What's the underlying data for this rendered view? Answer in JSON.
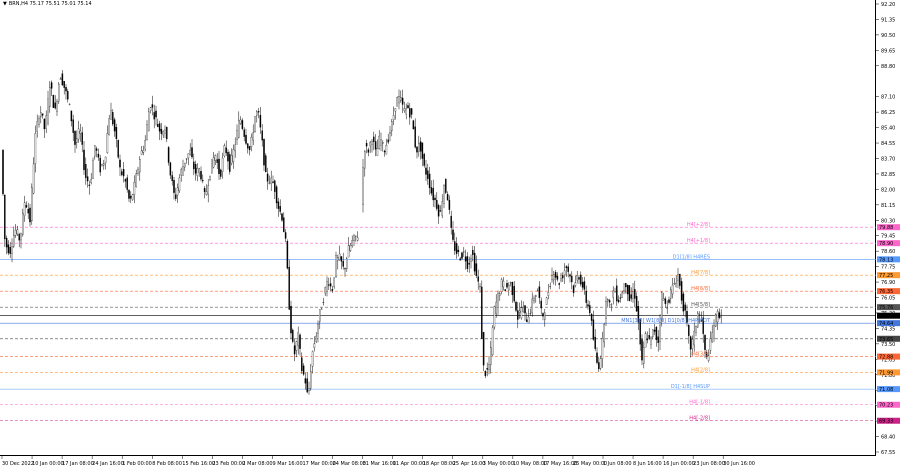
{
  "window": {
    "title": "BRN,H4  75.17 75.51 75.01 75.14"
  },
  "chart_data": {
    "type": "candlestick",
    "y_range": [
      67.55,
      92.2
    ],
    "price_ticks": [
      "92.20",
      "91.35",
      "90.50",
      "89.65",
      "88.80",
      "87.10",
      "86.25",
      "85.40",
      "84.55",
      "83.70",
      "82.85",
      "82.00",
      "81.15",
      "80.30",
      "79.45",
      "78.60",
      "77.75",
      "76.90",
      "76.05",
      "75.20",
      "74.35",
      "73.50",
      "72.65",
      "71.80",
      "70.95",
      "70.10",
      "69.25",
      "68.40",
      "67.55"
    ],
    "date_ticks": [
      "30 Dec 2022",
      "10 Jan 00:00",
      "17 Jan 08:00",
      "24 Jan 16:00",
      "1 Feb 00:00",
      "8 Feb 08:00",
      "15 Feb 16:00",
      "23 Feb 00:00",
      "2 Mar 08:00",
      "9 Mar 16:00",
      "17 Mar 00:00",
      "24 Mar 08:00",
      "31 Mar 16:00",
      "11 Apr 00:00",
      "18 Apr 08:00",
      "25 Apr 16:00",
      "3 May 00:00",
      "10 May 08:00",
      "17 May 16:00",
      "25 May 00:00",
      "1 Jun 08:00",
      "8 Jun 16:00",
      "16 Jun 00:00",
      "23 Jun 08:00",
      "30 Jun 16:00"
    ],
    "price_path": [
      [
        0,
        85.8
      ],
      [
        5,
        79
      ],
      [
        10,
        78.6
      ],
      [
        15,
        79.8
      ],
      [
        20,
        79.2
      ],
      [
        25,
        81.5
      ],
      [
        30,
        80.3
      ],
      [
        35,
        84.8
      ],
      [
        40,
        86.5
      ],
      [
        45,
        85.2
      ],
      [
        50,
        87.9
      ],
      [
        55,
        86.2
      ],
      [
        60,
        88.4
      ],
      [
        65,
        87.5
      ],
      [
        70,
        86.4
      ],
      [
        75,
        84.5
      ],
      [
        80,
        85.3
      ],
      [
        85,
        82.8
      ],
      [
        90,
        82.2
      ],
      [
        95,
        84.5
      ],
      [
        100,
        83.1
      ],
      [
        105,
        83.7
      ],
      [
        110,
        86.5
      ],
      [
        115,
        85.1
      ],
      [
        120,
        83.1
      ],
      [
        125,
        82.5
      ],
      [
        130,
        81.2
      ],
      [
        135,
        82.3
      ],
      [
        140,
        83.8
      ],
      [
        145,
        84.6
      ],
      [
        150,
        86.8
      ],
      [
        155,
        86
      ],
      [
        160,
        85.2
      ],
      [
        165,
        85.4
      ],
      [
        170,
        83
      ],
      [
        175,
        81.4
      ],
      [
        180,
        82.8
      ],
      [
        185,
        83.6
      ],
      [
        190,
        84.1
      ],
      [
        195,
        82.9
      ],
      [
        200,
        83.1
      ],
      [
        205,
        81.5
      ],
      [
        210,
        83
      ],
      [
        215,
        84
      ],
      [
        220,
        82.7
      ],
      [
        225,
        84.4
      ],
      [
        230,
        83.2
      ],
      [
        235,
        84.5
      ],
      [
        240,
        86
      ],
      [
        245,
        84.9
      ],
      [
        250,
        84.1
      ],
      [
        255,
        86
      ],
      [
        258,
        86.3
      ],
      [
        262,
        84.6
      ],
      [
        266,
        82.6
      ],
      [
        270,
        82.5
      ],
      [
        274,
        82.3
      ],
      [
        278,
        81.1
      ],
      [
        282,
        80.5
      ],
      [
        286,
        78.9
      ],
      [
        290,
        74.8
      ],
      [
        294,
        72.8
      ],
      [
        298,
        74
      ],
      [
        302,
        72
      ],
      [
        305,
        71.6
      ],
      [
        308,
        70.4
      ],
      [
        312,
        72.9
      ],
      [
        316,
        74
      ],
      [
        320,
        75.2
      ],
      [
        324,
        76.2
      ],
      [
        328,
        77.1
      ],
      [
        332,
        76.4
      ],
      [
        336,
        78.1
      ],
      [
        340,
        78.2
      ],
      [
        344,
        77.5
      ],
      [
        348,
        78.6
      ],
      [
        352,
        79.1
      ],
      [
        356,
        79.4
      ],
      [
        360,
        79.6
      ],
      [
        364,
        84.4
      ],
      [
        368,
        84.1
      ],
      [
        372,
        84.9
      ],
      [
        376,
        83.9
      ],
      [
        380,
        84.9
      ],
      [
        384,
        84.1
      ],
      [
        388,
        84.8
      ],
      [
        392,
        85.6
      ],
      [
        396,
        86.9
      ],
      [
        400,
        87
      ],
      [
        404,
        86.3
      ],
      [
        408,
        86.5
      ],
      [
        412,
        85.9
      ],
      [
        416,
        84.1
      ],
      [
        420,
        84.5
      ],
      [
        424,
        83.2
      ],
      [
        428,
        82.7
      ],
      [
        432,
        81.7
      ],
      [
        436,
        81.3
      ],
      [
        440,
        80.5
      ],
      [
        444,
        82.3
      ],
      [
        448,
        81.5
      ],
      [
        452,
        79.2
      ],
      [
        456,
        78.6
      ],
      [
        460,
        78.3
      ],
      [
        464,
        78.5
      ],
      [
        468,
        77.8
      ],
      [
        472,
        78.6
      ],
      [
        476,
        77.3
      ],
      [
        480,
        76.5
      ],
      [
        483,
        72.3
      ],
      [
        486,
        71.8
      ],
      [
        490,
        72.5
      ],
      [
        494,
        75.3
      ],
      [
        498,
        76.1
      ],
      [
        502,
        76.9
      ],
      [
        506,
        76.5
      ],
      [
        510,
        76.9
      ],
      [
        514,
        76.1
      ],
      [
        518,
        74.9
      ],
      [
        522,
        75.6
      ],
      [
        526,
        74.8
      ],
      [
        530,
        75.3
      ],
      [
        534,
        76.1
      ],
      [
        538,
        76.5
      ],
      [
        542,
        74.9
      ],
      [
        546,
        75.7
      ],
      [
        550,
        76.9
      ],
      [
        554,
        77.6
      ],
      [
        558,
        76.8
      ],
      [
        562,
        77.2
      ],
      [
        566,
        77.8
      ],
      [
        570,
        77.3
      ],
      [
        574,
        76.4
      ],
      [
        578,
        77.4
      ],
      [
        582,
        76.8
      ],
      [
        586,
        75.9
      ],
      [
        590,
        75.3
      ],
      [
        594,
        73.5
      ],
      [
        598,
        72.1
      ],
      [
        602,
        73.3
      ],
      [
        606,
        76.1
      ],
      [
        610,
        75.5
      ],
      [
        614,
        76.6
      ],
      [
        618,
        75.9
      ],
      [
        622,
        76.3
      ],
      [
        626,
        76.9
      ],
      [
        630,
        75.8
      ],
      [
        634,
        76.5
      ],
      [
        638,
        74.9
      ],
      [
        642,
        72.4
      ],
      [
        646,
        74.1
      ],
      [
        650,
        73.5
      ],
      [
        654,
        74.4
      ],
      [
        658,
        73.5
      ],
      [
        662,
        76.3
      ],
      [
        666,
        75.5
      ],
      [
        670,
        76.2
      ],
      [
        674,
        76.8
      ],
      [
        678,
        77.3
      ],
      [
        682,
        75.9
      ],
      [
        686,
        74.9
      ],
      [
        690,
        73.2
      ],
      [
        694,
        73.9
      ],
      [
        698,
        75.3
      ],
      [
        702,
        74.6
      ],
      [
        706,
        72.5
      ],
      [
        710,
        73.4
      ],
      [
        714,
        74.6
      ],
      [
        718,
        75.2
      ],
      [
        722,
        75.1
      ]
    ],
    "levels": [
      {
        "label": "H4[+2/8]",
        "price": 79.92,
        "color": "#ff66cc",
        "badge": "79.88",
        "dash": true
      },
      {
        "label": "H4[+1/8]",
        "price": 79.04,
        "color": "#ff66cc",
        "badge": "78.90",
        "dash": true
      },
      {
        "label": "D1[1/8] H4RES",
        "price": 78.15,
        "color": "#5599ff",
        "badge": "78.13",
        "dash": false
      },
      {
        "label": "H4[7/8]",
        "price": 77.28,
        "color": "#ff9933",
        "badge": "77.25",
        "dash": true
      },
      {
        "label": "H4[6/8]",
        "price": 76.4,
        "color": "#ff6633",
        "badge": "76.35",
        "dash": true
      },
      {
        "label": "H4[5/8]",
        "price": 75.52,
        "color": "#555555",
        "badge": "75.76",
        "dash": true
      },
      {
        "label": "",
        "price": 75.05,
        "color": "#000000",
        "badge": "75.14",
        "dash": false
      },
      {
        "label": "MN1[3/8] W1[8/8] D1[0/8] H4PIVOT",
        "price": 74.64,
        "color": "#4477dd",
        "badge": "74.64",
        "dash": false
      },
      {
        "label": "",
        "price": 73.78,
        "color": "#444444",
        "badge": "73.65",
        "dash": true
      },
      {
        "label": "H4[3/8]",
        "price": 72.8,
        "color": "#ff6633",
        "badge": "72.88",
        "dash": true
      },
      {
        "label": "H4[2/8]",
        "price": 71.93,
        "color": "#ff9933",
        "badge": "71.99",
        "dash": true
      },
      {
        "label": "D1[-1/8] H4SUP",
        "price": 71.01,
        "color": "#5599ff",
        "badge": "71.08",
        "dash": false
      },
      {
        "label": "H4[-1/8]",
        "price": 70.15,
        "color": "#ff66cc",
        "badge": "70.23",
        "dash": true
      },
      {
        "label": "H4[-2/8]",
        "price": 69.27,
        "color": "#cc2288",
        "badge": "69.33",
        "dash": true
      }
    ]
  }
}
